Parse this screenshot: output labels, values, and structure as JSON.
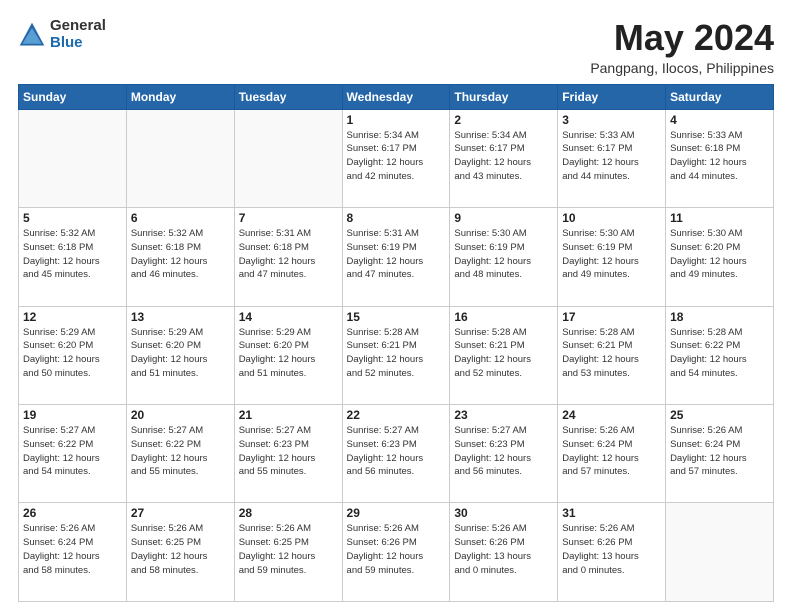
{
  "logo": {
    "general": "General",
    "blue": "Blue"
  },
  "header": {
    "month": "May 2024",
    "location": "Pangpang, Ilocos, Philippines"
  },
  "weekdays": [
    "Sunday",
    "Monday",
    "Tuesday",
    "Wednesday",
    "Thursday",
    "Friday",
    "Saturday"
  ],
  "weeks": [
    [
      {
        "day": "",
        "info": ""
      },
      {
        "day": "",
        "info": ""
      },
      {
        "day": "",
        "info": ""
      },
      {
        "day": "1",
        "info": "Sunrise: 5:34 AM\nSunset: 6:17 PM\nDaylight: 12 hours\nand 42 minutes."
      },
      {
        "day": "2",
        "info": "Sunrise: 5:34 AM\nSunset: 6:17 PM\nDaylight: 12 hours\nand 43 minutes."
      },
      {
        "day": "3",
        "info": "Sunrise: 5:33 AM\nSunset: 6:17 PM\nDaylight: 12 hours\nand 44 minutes."
      },
      {
        "day": "4",
        "info": "Sunrise: 5:33 AM\nSunset: 6:18 PM\nDaylight: 12 hours\nand 44 minutes."
      }
    ],
    [
      {
        "day": "5",
        "info": "Sunrise: 5:32 AM\nSunset: 6:18 PM\nDaylight: 12 hours\nand 45 minutes."
      },
      {
        "day": "6",
        "info": "Sunrise: 5:32 AM\nSunset: 6:18 PM\nDaylight: 12 hours\nand 46 minutes."
      },
      {
        "day": "7",
        "info": "Sunrise: 5:31 AM\nSunset: 6:18 PM\nDaylight: 12 hours\nand 47 minutes."
      },
      {
        "day": "8",
        "info": "Sunrise: 5:31 AM\nSunset: 6:19 PM\nDaylight: 12 hours\nand 47 minutes."
      },
      {
        "day": "9",
        "info": "Sunrise: 5:30 AM\nSunset: 6:19 PM\nDaylight: 12 hours\nand 48 minutes."
      },
      {
        "day": "10",
        "info": "Sunrise: 5:30 AM\nSunset: 6:19 PM\nDaylight: 12 hours\nand 49 minutes."
      },
      {
        "day": "11",
        "info": "Sunrise: 5:30 AM\nSunset: 6:20 PM\nDaylight: 12 hours\nand 49 minutes."
      }
    ],
    [
      {
        "day": "12",
        "info": "Sunrise: 5:29 AM\nSunset: 6:20 PM\nDaylight: 12 hours\nand 50 minutes."
      },
      {
        "day": "13",
        "info": "Sunrise: 5:29 AM\nSunset: 6:20 PM\nDaylight: 12 hours\nand 51 minutes."
      },
      {
        "day": "14",
        "info": "Sunrise: 5:29 AM\nSunset: 6:20 PM\nDaylight: 12 hours\nand 51 minutes."
      },
      {
        "day": "15",
        "info": "Sunrise: 5:28 AM\nSunset: 6:21 PM\nDaylight: 12 hours\nand 52 minutes."
      },
      {
        "day": "16",
        "info": "Sunrise: 5:28 AM\nSunset: 6:21 PM\nDaylight: 12 hours\nand 52 minutes."
      },
      {
        "day": "17",
        "info": "Sunrise: 5:28 AM\nSunset: 6:21 PM\nDaylight: 12 hours\nand 53 minutes."
      },
      {
        "day": "18",
        "info": "Sunrise: 5:28 AM\nSunset: 6:22 PM\nDaylight: 12 hours\nand 54 minutes."
      }
    ],
    [
      {
        "day": "19",
        "info": "Sunrise: 5:27 AM\nSunset: 6:22 PM\nDaylight: 12 hours\nand 54 minutes."
      },
      {
        "day": "20",
        "info": "Sunrise: 5:27 AM\nSunset: 6:22 PM\nDaylight: 12 hours\nand 55 minutes."
      },
      {
        "day": "21",
        "info": "Sunrise: 5:27 AM\nSunset: 6:23 PM\nDaylight: 12 hours\nand 55 minutes."
      },
      {
        "day": "22",
        "info": "Sunrise: 5:27 AM\nSunset: 6:23 PM\nDaylight: 12 hours\nand 56 minutes."
      },
      {
        "day": "23",
        "info": "Sunrise: 5:27 AM\nSunset: 6:23 PM\nDaylight: 12 hours\nand 56 minutes."
      },
      {
        "day": "24",
        "info": "Sunrise: 5:26 AM\nSunset: 6:24 PM\nDaylight: 12 hours\nand 57 minutes."
      },
      {
        "day": "25",
        "info": "Sunrise: 5:26 AM\nSunset: 6:24 PM\nDaylight: 12 hours\nand 57 minutes."
      }
    ],
    [
      {
        "day": "26",
        "info": "Sunrise: 5:26 AM\nSunset: 6:24 PM\nDaylight: 12 hours\nand 58 minutes."
      },
      {
        "day": "27",
        "info": "Sunrise: 5:26 AM\nSunset: 6:25 PM\nDaylight: 12 hours\nand 58 minutes."
      },
      {
        "day": "28",
        "info": "Sunrise: 5:26 AM\nSunset: 6:25 PM\nDaylight: 12 hours\nand 59 minutes."
      },
      {
        "day": "29",
        "info": "Sunrise: 5:26 AM\nSunset: 6:26 PM\nDaylight: 12 hours\nand 59 minutes."
      },
      {
        "day": "30",
        "info": "Sunrise: 5:26 AM\nSunset: 6:26 PM\nDaylight: 13 hours\nand 0 minutes."
      },
      {
        "day": "31",
        "info": "Sunrise: 5:26 AM\nSunset: 6:26 PM\nDaylight: 13 hours\nand 0 minutes."
      },
      {
        "day": "",
        "info": ""
      }
    ]
  ]
}
